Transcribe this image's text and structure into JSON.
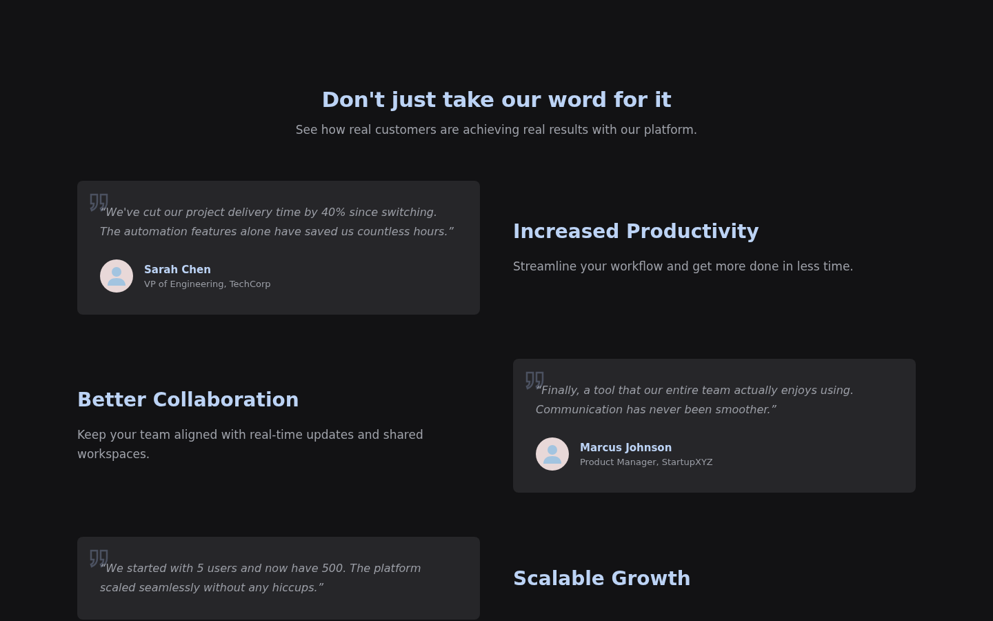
{
  "header": {
    "title": "Don't just take our word for it",
    "subtitle": "See how real customers are achieving real results with our platform."
  },
  "rows": [
    {
      "items": [
        {
          "kind": "testimonial",
          "quote": "“We've cut our project delivery time by 40% since switching. The automation features alone have saved us countless hours.”",
          "name": "Sarah Chen",
          "role": "VP of Engineering, TechCorp"
        },
        {
          "kind": "feature",
          "title": "Increased Productivity",
          "text": "Streamline your workflow and get more done in less time."
        }
      ]
    },
    {
      "items": [
        {
          "kind": "feature",
          "title": "Better Collaboration",
          "text": "Keep your team aligned with real-time updates and shared workspaces."
        },
        {
          "kind": "testimonial",
          "quote": "“Finally, a tool that our entire team actually enjoys using. Communication has never been smoother.”",
          "name": "Marcus Johnson",
          "role": "Product Manager, StartupXYZ"
        }
      ]
    },
    {
      "items": [
        {
          "kind": "testimonial",
          "quote": "“We started with 5 users and now have 500. The platform scaled seamlessly without any hiccups.”"
        },
        {
          "kind": "feature",
          "title": "Scalable Growth"
        }
      ]
    }
  ]
}
